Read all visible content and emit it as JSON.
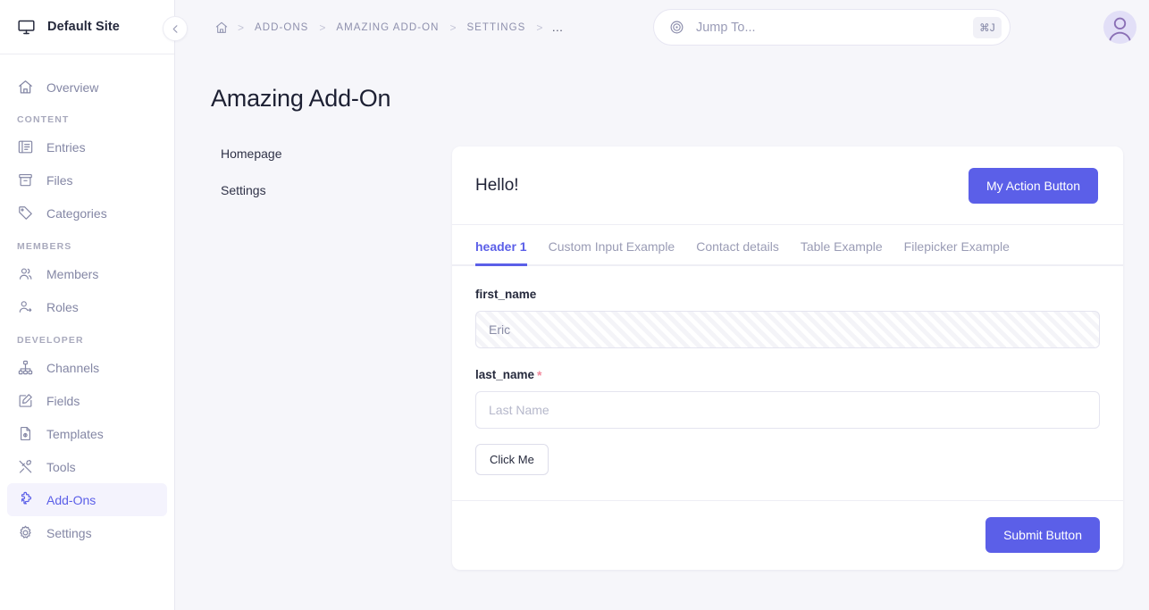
{
  "sidebar": {
    "site_name": "Default Site",
    "site_icon": "monitor-icon",
    "collapse_icon": "chevron-left-icon",
    "groups": [
      {
        "label": "",
        "items": [
          {
            "label": "Overview",
            "icon": "home-icon",
            "active": false
          }
        ]
      },
      {
        "label": "CONTENT",
        "items": [
          {
            "label": "Entries",
            "icon": "entries-icon",
            "active": false
          },
          {
            "label": "Files",
            "icon": "files-icon",
            "active": false
          },
          {
            "label": "Categories",
            "icon": "tag-icon",
            "active": false
          }
        ]
      },
      {
        "label": "MEMBERS",
        "items": [
          {
            "label": "Members",
            "icon": "members-icon",
            "active": false
          },
          {
            "label": "Roles",
            "icon": "roles-icon",
            "active": false
          }
        ]
      },
      {
        "label": "DEVELOPER",
        "items": [
          {
            "label": "Channels",
            "icon": "channels-icon",
            "active": false
          },
          {
            "label": "Fields",
            "icon": "fields-icon",
            "active": false
          },
          {
            "label": "Templates",
            "icon": "templates-icon",
            "active": false
          },
          {
            "label": "Tools",
            "icon": "tools-icon",
            "active": false
          },
          {
            "label": "Add-Ons",
            "icon": "puzzle-icon",
            "active": true
          },
          {
            "label": "Settings",
            "icon": "gear-icon",
            "active": false
          }
        ]
      }
    ]
  },
  "topbar": {
    "breadcrumb": [
      {
        "label": "",
        "icon": "home-icon"
      },
      {
        "label": "ADD-ONS"
      },
      {
        "label": "AMAZING ADD-ON"
      },
      {
        "label": "SETTINGS"
      },
      {
        "label": "…"
      }
    ],
    "separator": ">",
    "search": {
      "placeholder": "Jump To...",
      "value": "",
      "icon": "target-icon",
      "shortcut": "⌘J"
    },
    "avatar": "user-avatar"
  },
  "page": {
    "title": "Amazing Add-On",
    "subnav": [
      {
        "label": "Homepage"
      },
      {
        "label": "Settings"
      }
    ]
  },
  "card": {
    "title": "Hello!",
    "action_button": "My Action Button",
    "tabs": [
      {
        "label": "header 1",
        "active": true
      },
      {
        "label": "Custom Input Example",
        "active": false
      },
      {
        "label": "Contact details",
        "active": false
      },
      {
        "label": "Table Example",
        "active": false
      },
      {
        "label": "Filepicker Example",
        "active": false
      }
    ],
    "fields": [
      {
        "label": "first_name",
        "required": false,
        "required_marker": "",
        "value": "Eric",
        "placeholder": "",
        "disabled": true
      },
      {
        "label": "last_name",
        "required": true,
        "required_marker": "*",
        "value": "",
        "placeholder": "Last Name",
        "disabled": false
      }
    ],
    "inline_button": "Click Me",
    "submit_button": "Submit Button"
  },
  "colors": {
    "accent": "#5b5fe8",
    "page_bg": "#f6f6fa",
    "card_bg": "#ffffff",
    "sidebar_active_bg": "#f4f3fd",
    "required_marker": "#f2899c",
    "muted_text": "#8487a5"
  }
}
